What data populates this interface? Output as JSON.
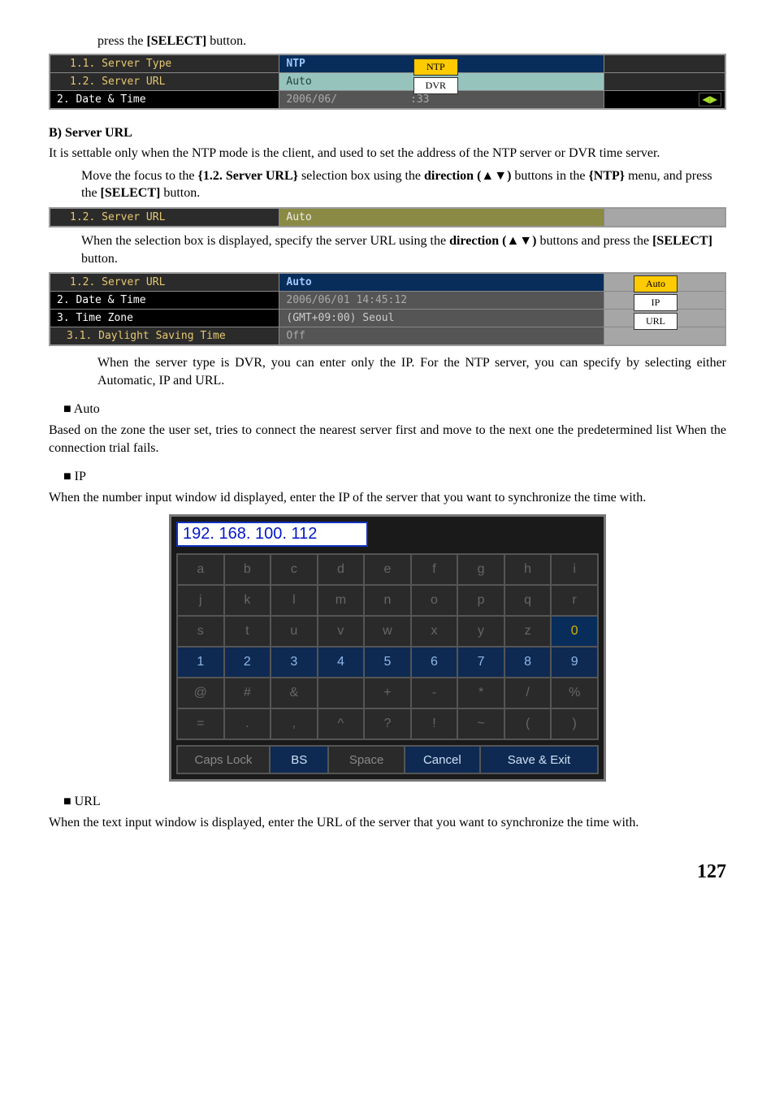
{
  "intro": {
    "lead": "press the ",
    "select_btn": "[SELECT]",
    "tail": " button."
  },
  "fig1": {
    "rows": [
      {
        "label": "1.1. Server Type",
        "value": "NTP"
      },
      {
        "label": "1.2. Server URL",
        "value": "Auto"
      },
      {
        "label": "2. Date & Time",
        "value": "2006/06/",
        "value_tail": ":33"
      }
    ],
    "popup": {
      "top": "NTP",
      "bottom": "DVR"
    },
    "nav": "◀▶"
  },
  "secB": {
    "title": "B)  Server URL",
    "body": "It is settable only when the NTP mode is the client, and used to set the address of the NTP server or DVR time server.",
    "step1_a": "Move the focus to the ",
    "step1_b": "{1.2. Server URL}",
    "step1_c": " selection box using the ",
    "step1_d": "direction (▲▼)",
    "step1_e": " buttons in the ",
    "step1_f": "{NTP}",
    "step1_g": " menu, and press the ",
    "select_btn": "[SELECT]",
    "step1_h": " button."
  },
  "fig2": {
    "label": "1.2. Server URL",
    "value": "Auto"
  },
  "step2": {
    "a": "When the selection box is displayed, specify the server URL using the ",
    "b": "direction (▲▼)",
    "c": " buttons and press the ",
    "d": "[SELECT]",
    "e": " button."
  },
  "fig3": {
    "rows": [
      {
        "label": "1.2. Server URL",
        "value": "Auto"
      },
      {
        "label": "2. Date & Time",
        "value": "2006/06/01   14:45:12"
      },
      {
        "label": "3. Time Zone",
        "value": "(GMT+09:00) Seoul"
      },
      {
        "label": "3.1. Daylight Saving Time",
        "value": "Off"
      }
    ],
    "popup": [
      "Auto",
      "IP",
      "URL"
    ]
  },
  "after3": "When the server type is DVR, you can enter only the IP. For the NTP server, you can specify by selecting either Automatic, IP and URL.",
  "auto": {
    "title": "■ Auto",
    "body": "Based on the zone the user set, tries to connect the nearest server first and move to the next one the predetermined list When the connection trial fails."
  },
  "ip": {
    "title": "■ IP",
    "body": "When the number input window id displayed, enter the IP of the server that you want to synchronize the time with."
  },
  "keypad": {
    "input": "192. 168. 100. 112",
    "rows": [
      [
        "a",
        "b",
        "c",
        "d",
        "e",
        "f",
        "g",
        "h",
        "i"
      ],
      [
        "j",
        "k",
        "l",
        "m",
        "n",
        "o",
        "p",
        "q",
        "r"
      ],
      [
        "s",
        "t",
        "u",
        "v",
        "w",
        "x",
        "y",
        "z",
        "0"
      ],
      [
        "1",
        "2",
        "3",
        "4",
        "5",
        "6",
        "7",
        "8",
        "9"
      ],
      [
        "@",
        "#",
        "&",
        "",
        "+",
        "-",
        "*",
        "/",
        "%"
      ],
      [
        "=",
        ".",
        ",",
        "^",
        "?",
        "!",
        "~",
        "(",
        ")"
      ]
    ],
    "actions": [
      "Caps Lock",
      "BS",
      "Space",
      "Cancel",
      "Save & Exit"
    ]
  },
  "url": {
    "title": "■ URL",
    "body": "When the text input window is displayed, enter the URL of the server that you want to synchronize the time with."
  },
  "page": "127"
}
